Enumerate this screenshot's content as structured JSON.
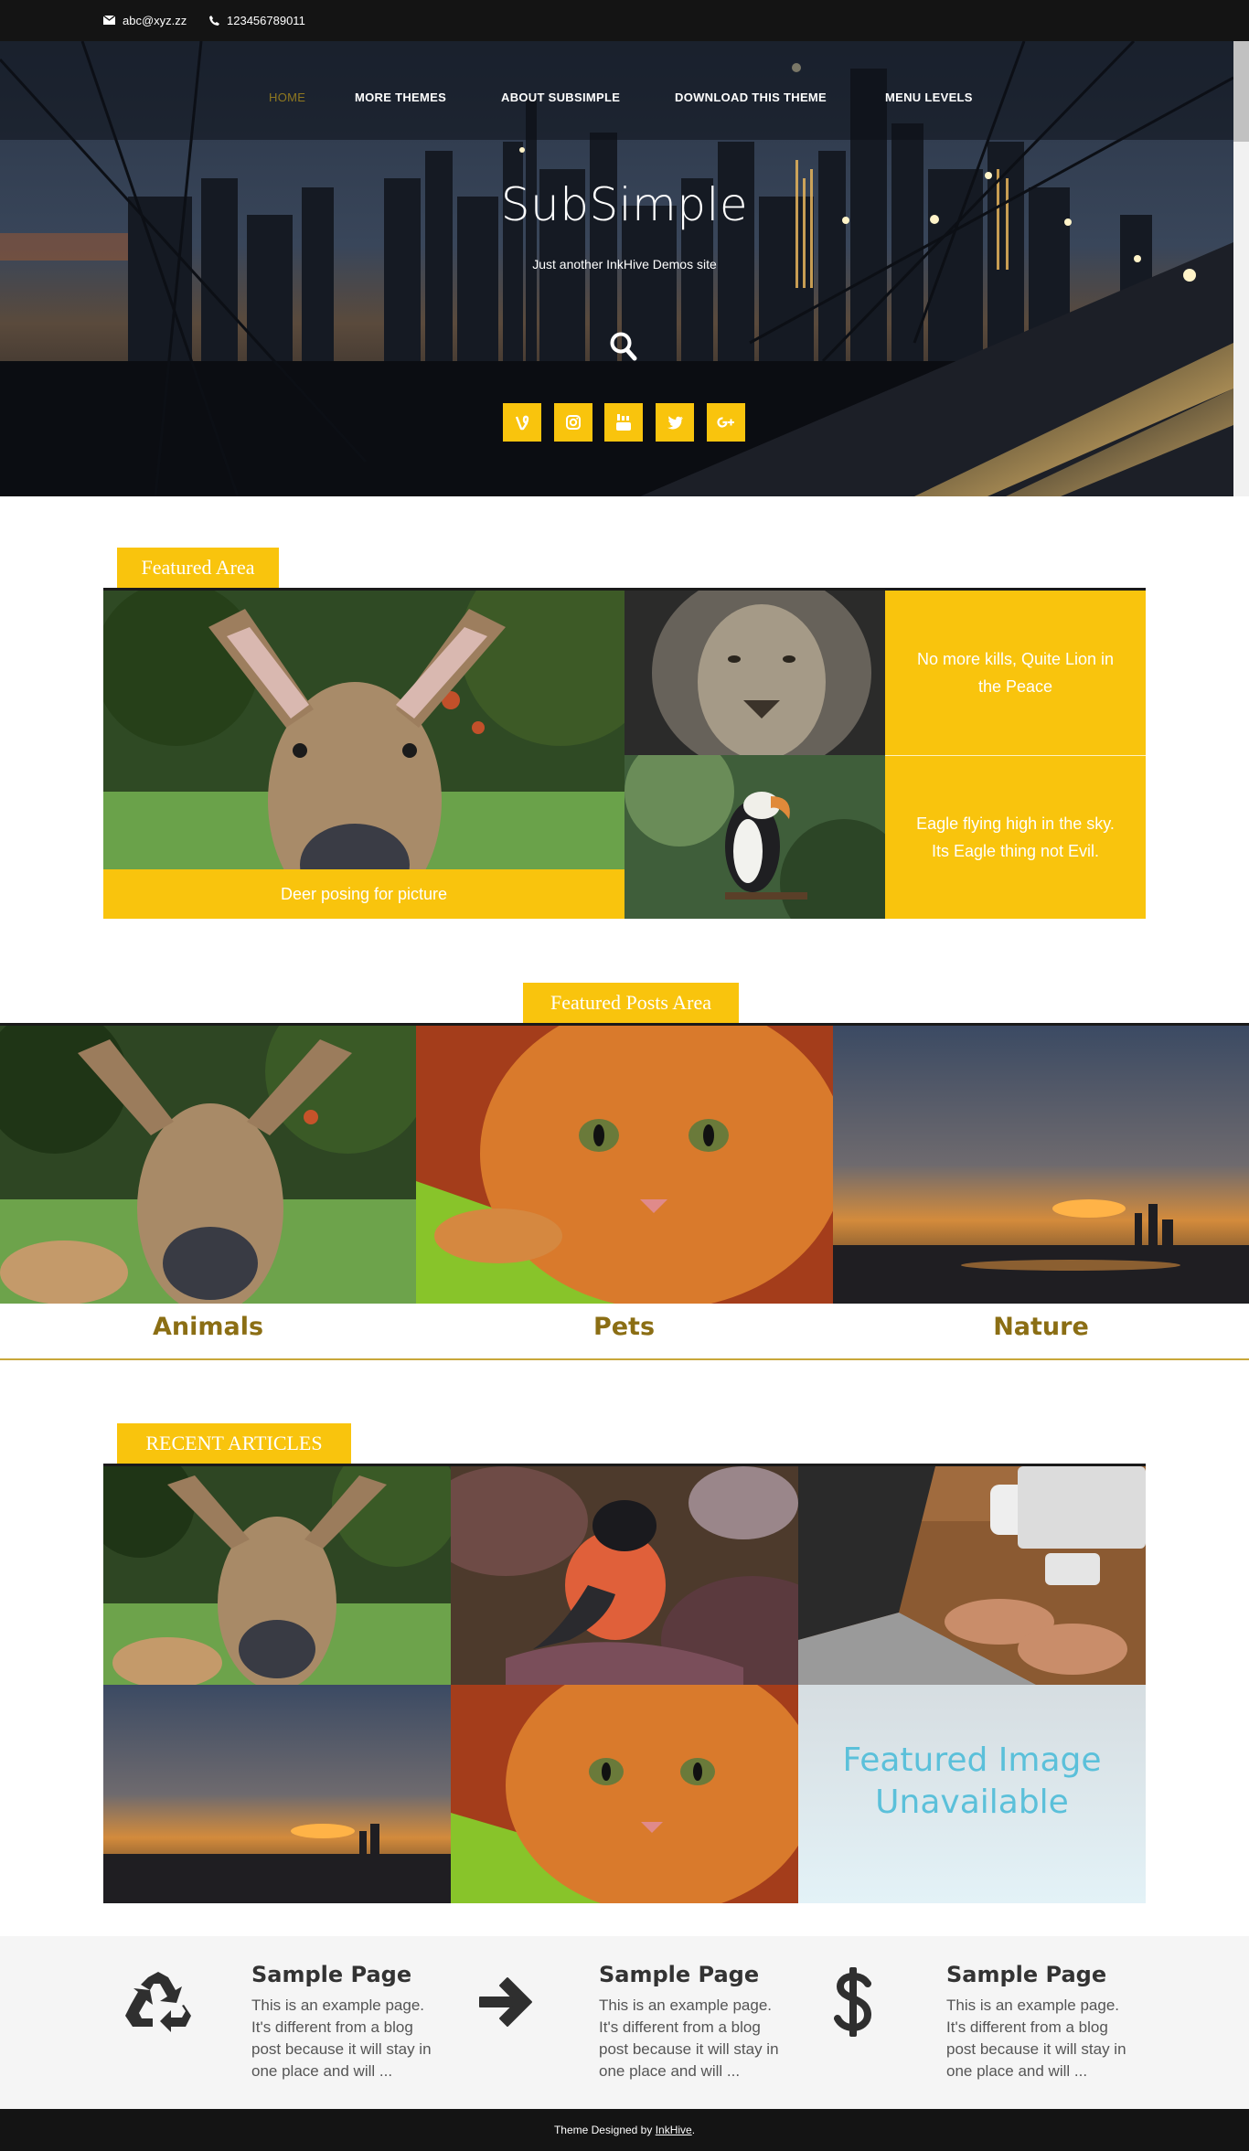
{
  "topbar": {
    "email": "abc@xyz.zz",
    "phone": "123456789011"
  },
  "nav": {
    "items": [
      {
        "label": "HOME",
        "active": true
      },
      {
        "label": "MORE THEMES",
        "active": false
      },
      {
        "label": "ABOUT SUBSIMPLE",
        "active": false
      },
      {
        "label": "DOWNLOAD THIS THEME",
        "active": false
      },
      {
        "label": "MENU LEVELS",
        "active": false
      }
    ]
  },
  "hero": {
    "title": "SubSimple",
    "tagline": "Just another InkHive Demos site",
    "search_icon": "search-icon",
    "socials": [
      "vine-icon",
      "instagram-icon",
      "youtube-icon",
      "twitter-icon",
      "google-plus-icon"
    ]
  },
  "featured_area": {
    "heading": "Featured Area",
    "items": [
      {
        "caption": "Deer posing for picture"
      },
      {
        "caption": "No more kills, Quite Lion in the Peace"
      },
      {
        "caption": "Eagle flying high in the sky. Its Eagle thing not Evil."
      }
    ]
  },
  "featured_posts": {
    "heading": "Featured Posts Area",
    "categories": [
      "Animals",
      "Pets",
      "Nature"
    ]
  },
  "recent_articles": {
    "heading": "RECENT ARTICLES",
    "unavailable_text_line1": "Featured Image",
    "unavailable_text_line2": "Unavailable"
  },
  "widgets": [
    {
      "icon": "recycle-icon",
      "title": "Sample Page",
      "text": "This is an example page. It's different from a blog post because it will stay in one place and will ..."
    },
    {
      "icon": "arrow-right-icon",
      "title": "Sample Page",
      "text": "This is an example page. It's different from a blog post because it will stay in one place and will ..."
    },
    {
      "icon": "dollar-icon",
      "title": "Sample Page",
      "text": "This is an example page. It's different from a blog post because it will stay in one place and will ..."
    }
  ],
  "footer": {
    "prefix": "Theme Designed by ",
    "link": "InkHive",
    "suffix": "."
  },
  "colors": {
    "accent": "#f9c40d",
    "category_text": "#8b6e14",
    "topbar": "#141414"
  }
}
